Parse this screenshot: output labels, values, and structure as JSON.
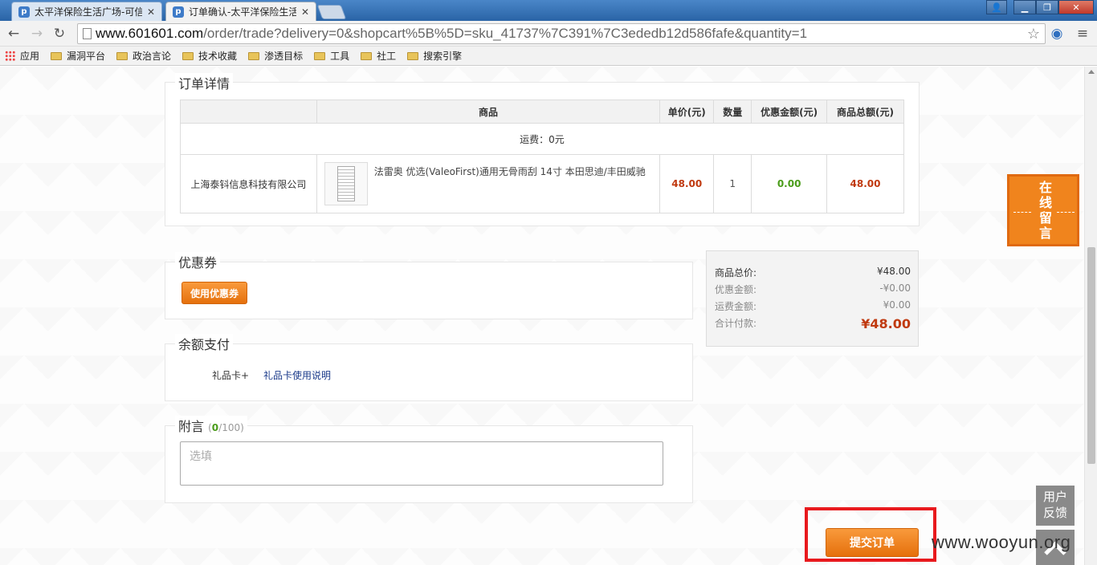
{
  "browser": {
    "tabs": [
      {
        "title": "太平洋保险生活广场-可信",
        "active": false
      },
      {
        "title": "订单确认-太平洋保险生活",
        "active": true
      }
    ],
    "url_host": "www.601601.com",
    "url_path": "/order/trade?delivery=0&shopcart%5B%5D=sku_41737%7C391%7C3ededb12d586fafe&quantity=1",
    "bookmarks": [
      "应用",
      "漏洞平台",
      "政治言论",
      "技术收藏",
      "渗透目标",
      "工具",
      "社工",
      "搜索引擎"
    ]
  },
  "order": {
    "section_title": "订单详情",
    "headers": [
      "商品",
      "单价(元)",
      "数量",
      "优惠金额(元)",
      "商品总额(元)"
    ],
    "shipping": "运费：0元",
    "seller": "上海泰钭信息科技有限公司",
    "product_name": "法雷奥 优选(ValeoFirst)通用无骨雨刮 14寸 本田思迪/丰田威驰",
    "unit_price": "48.00",
    "quantity": "1",
    "discount": "0.00",
    "total": "48.00"
  },
  "coupon": {
    "title": "优惠券",
    "button": "使用优惠券"
  },
  "balance": {
    "title": "余额支付",
    "giftcard_label": "礼品卡+",
    "giftcard_link": "礼品卡使用说明"
  },
  "note": {
    "title": "附言",
    "count": "0",
    "max": "/100",
    "placeholder": "选填"
  },
  "summary": {
    "goods_label": "商品总价:",
    "goods_value": "¥48.00",
    "discount_label": "优惠金额:",
    "discount_value": "-¥0.00",
    "shipping_label": "运费金额:",
    "shipping_value": "¥0.00",
    "pay_label": "合计付款:",
    "pay_value": "¥48.00"
  },
  "submit": "提交订单",
  "float_message": [
    "在",
    "线",
    "留",
    "言"
  ],
  "feedback": [
    "用户",
    "反馈"
  ],
  "watermark": "www.wooyun.org"
}
